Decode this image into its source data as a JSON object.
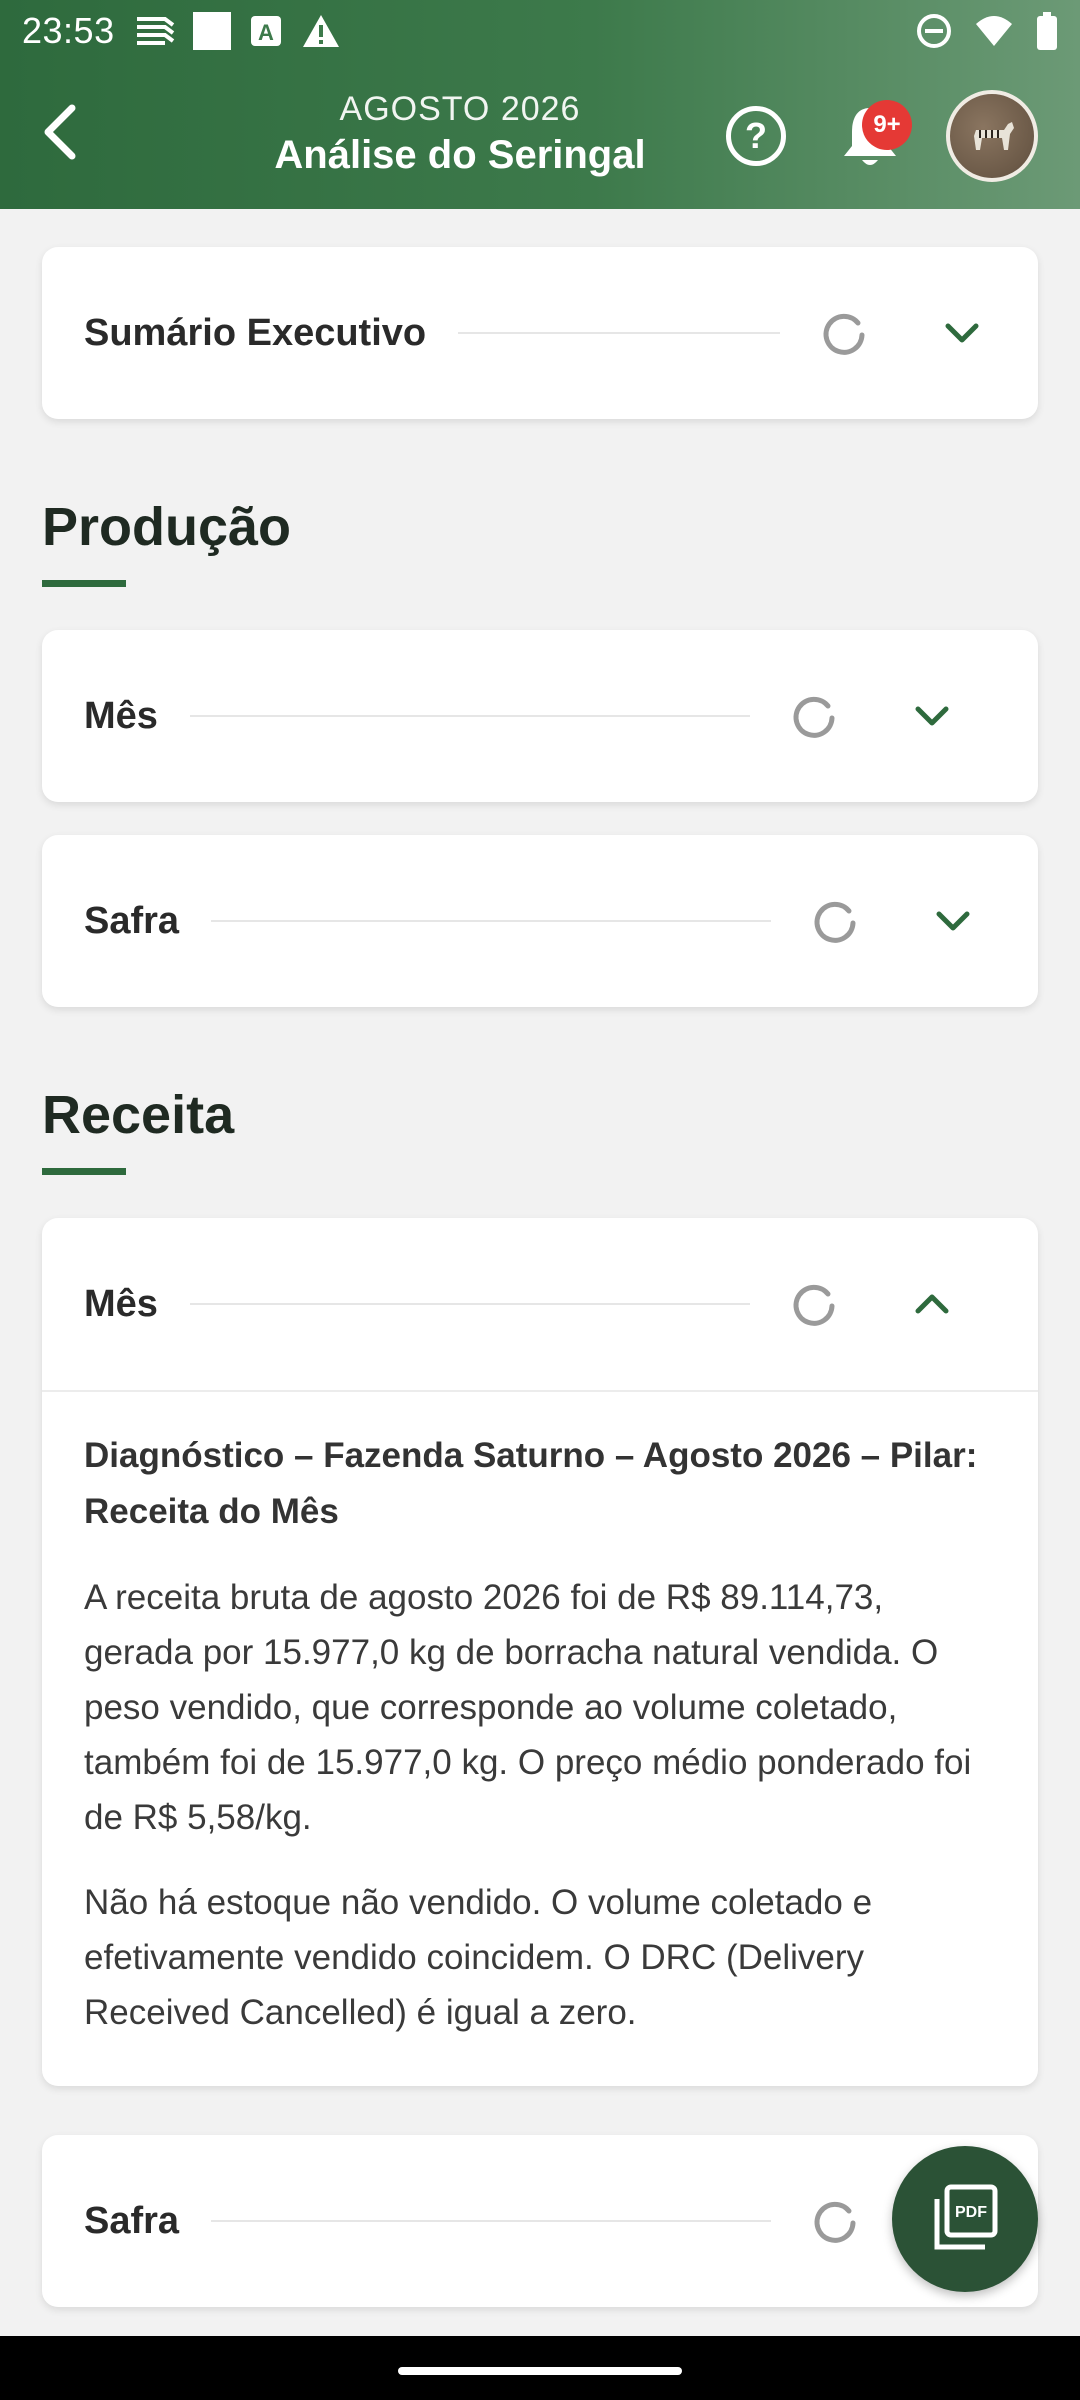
{
  "status_bar": {
    "time": "23:53"
  },
  "app_bar": {
    "subtitle": "AGOSTO 2026",
    "title": "Análise do Seringal",
    "notification_badge": "9+"
  },
  "sections": {
    "summary_card": {
      "title": "Sumário Executivo"
    },
    "producao": {
      "heading": "Produção",
      "cards": [
        {
          "title": "Mês"
        },
        {
          "title": "Safra"
        }
      ]
    },
    "receita": {
      "heading": "Receita",
      "mes_card": {
        "title": "Mês",
        "diagnostic_title": "Diagnóstico – Fazenda Saturno – Agosto 2026 – Pilar: Receita do Mês",
        "paragraph_1": "A receita bruta de agosto 2026 foi de R$ 89.114,73, gerada por 15.977,0 kg de borracha natural vendida. O peso vendido, que corresponde ao volume coletado, também foi de 15.977,0 kg.  O preço médio ponderado foi de R$ 5,58/kg.",
        "paragraph_2": "Não há estoque não vendido.  O volume coletado e efetivamente vendido coincidem. O DRC (Delivery Received Cancelled) é igual a zero."
      },
      "safra_card": {
        "title": "Safra"
      }
    }
  },
  "fab": {
    "icon": "pdf-icon"
  },
  "colors": {
    "primary": "#2e6a3d",
    "fab": "#2b5236",
    "badge": "#e53935",
    "background": "#f2f2f2"
  }
}
